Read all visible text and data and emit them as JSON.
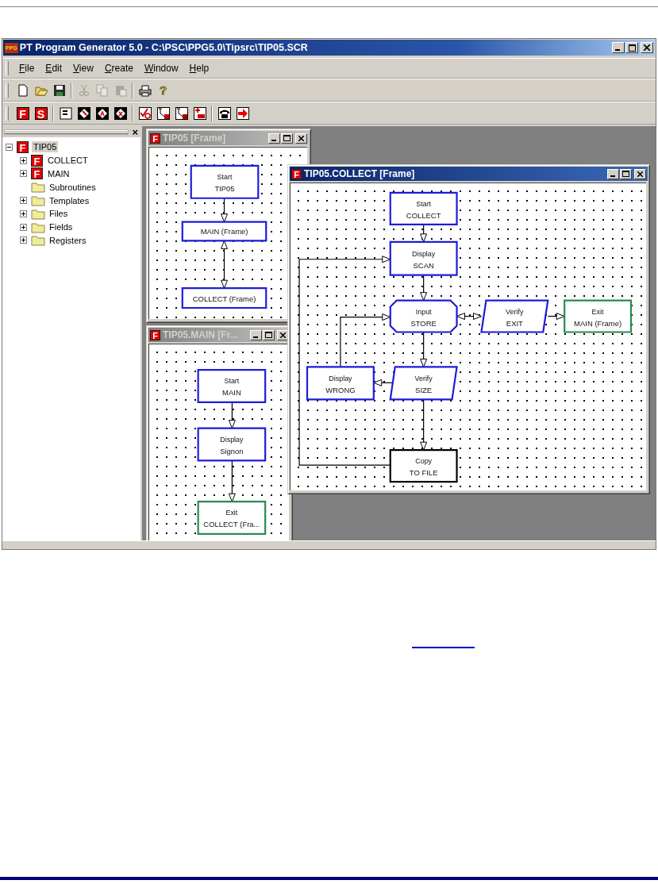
{
  "app": {
    "icon_text": "PPG",
    "title": "PT Program Generator 5.0 - C:\\PSC\\PPG5.0\\Tipsrc\\TIP05.SCR"
  },
  "menu": [
    "File",
    "Edit",
    "View",
    "Create",
    "Window",
    "Help"
  ],
  "toolbar_1": [
    {
      "kind": "new",
      "disabled": false
    },
    {
      "kind": "open",
      "disabled": false
    },
    {
      "kind": "save",
      "disabled": false
    },
    {
      "kind": "separator"
    },
    {
      "kind": "cut",
      "disabled": true
    },
    {
      "kind": "copy",
      "disabled": true
    },
    {
      "kind": "paste",
      "disabled": true
    },
    {
      "kind": "separator"
    },
    {
      "kind": "print",
      "disabled": false
    },
    {
      "kind": "help",
      "glyph": "?"
    }
  ],
  "toolbar_2": [
    {
      "kind": "letter",
      "glyph": "F"
    },
    {
      "kind": "letter",
      "glyph": "S"
    },
    {
      "kind": "separator"
    },
    {
      "kind": "frame"
    },
    {
      "kind": "diamond"
    },
    {
      "kind": "diamond-a"
    },
    {
      "kind": "diamond-x"
    },
    {
      "kind": "separator"
    },
    {
      "kind": "check"
    },
    {
      "kind": "link-a"
    },
    {
      "kind": "link-b"
    },
    {
      "kind": "list-plus"
    },
    {
      "kind": "separator"
    },
    {
      "kind": "phone"
    },
    {
      "kind": "exit"
    }
  ],
  "tree_panel": {
    "close": "×",
    "items": [
      {
        "label": "TIP05",
        "kind": "frame",
        "glyph": "F",
        "selected": true,
        "has_children": true,
        "expanded": true,
        "children": [
          {
            "label": "COLLECT",
            "kind": "frame",
            "glyph": "F",
            "selected": false,
            "has_children": true,
            "expanded": false
          },
          {
            "label": "MAIN",
            "kind": "frame",
            "glyph": "F",
            "selected": false,
            "has_children": true,
            "expanded": false
          },
          {
            "label": "Subroutines",
            "kind": "folder",
            "selected": false,
            "has_children": false,
            "expanded": false
          },
          {
            "label": "Templates",
            "kind": "folder",
            "selected": false,
            "has_children": true,
            "expanded": false
          },
          {
            "label": "Files",
            "kind": "folder",
            "selected": false,
            "has_children": true,
            "expanded": false
          },
          {
            "label": "Fields",
            "kind": "folder",
            "selected": false,
            "has_children": true,
            "expanded": false
          },
          {
            "label": "Registers",
            "kind": "folder",
            "selected": false,
            "has_children": true,
            "expanded": false
          }
        ]
      }
    ]
  },
  "windows": [
    {
      "title": "TIP05 [Frame]",
      "icon_glyph": "F",
      "active": false,
      "nodes": [
        {
          "kind": "process",
          "color": "#1c1cdc",
          "lines": [
            "Start",
            "TIP05"
          ]
        },
        {
          "kind": "process",
          "color": "#1c1cdc",
          "lines": [
            "MAIN (Frame)"
          ]
        },
        {
          "kind": "process",
          "color": "#1c1cdc",
          "lines": [
            "COLLECT (Frame)"
          ]
        }
      ]
    },
    {
      "title": "TIP05.MAIN [Fr...",
      "icon_glyph": "F",
      "active": false,
      "nodes": [
        {
          "kind": "process",
          "color": "#1c1cdc",
          "lines": [
            "Start",
            "MAIN"
          ]
        },
        {
          "kind": "process",
          "color": "#1c1cdc",
          "lines": [
            "Display",
            "Signon"
          ]
        },
        {
          "kind": "process",
          "color": "#2a8a4e",
          "lines": [
            "Exit",
            "COLLECT (Fra..."
          ]
        }
      ]
    },
    {
      "title": "TIP05.COLLECT [Frame]",
      "icon_glyph": "F",
      "active": true,
      "nodes": [
        {
          "kind": "process",
          "color": "#1c1cdc",
          "lines": [
            "Start",
            "COLLECT"
          ]
        },
        {
          "kind": "process",
          "color": "#1c1cdc",
          "lines": [
            "Display",
            "SCAN"
          ]
        },
        {
          "kind": "input",
          "color": "#1c1cdc",
          "lines": [
            "Input",
            "STORE"
          ]
        },
        {
          "kind": "verify",
          "color": "#1c1cdc",
          "lines": [
            "Verify",
            "EXIT"
          ]
        },
        {
          "kind": "process",
          "color": "#2a8a4e",
          "lines": [
            "Exit",
            "MAIN (Frame)"
          ]
        },
        {
          "kind": "process",
          "color": "#1c1cdc",
          "lines": [
            "Display",
            "WRONG"
          ]
        },
        {
          "kind": "verify",
          "color": "#1c1cdc",
          "lines": [
            "Verify",
            "SIZE"
          ]
        },
        {
          "kind": "process",
          "color": "#000000",
          "lines": [
            "Copy",
            "TO FILE"
          ]
        }
      ]
    }
  ]
}
